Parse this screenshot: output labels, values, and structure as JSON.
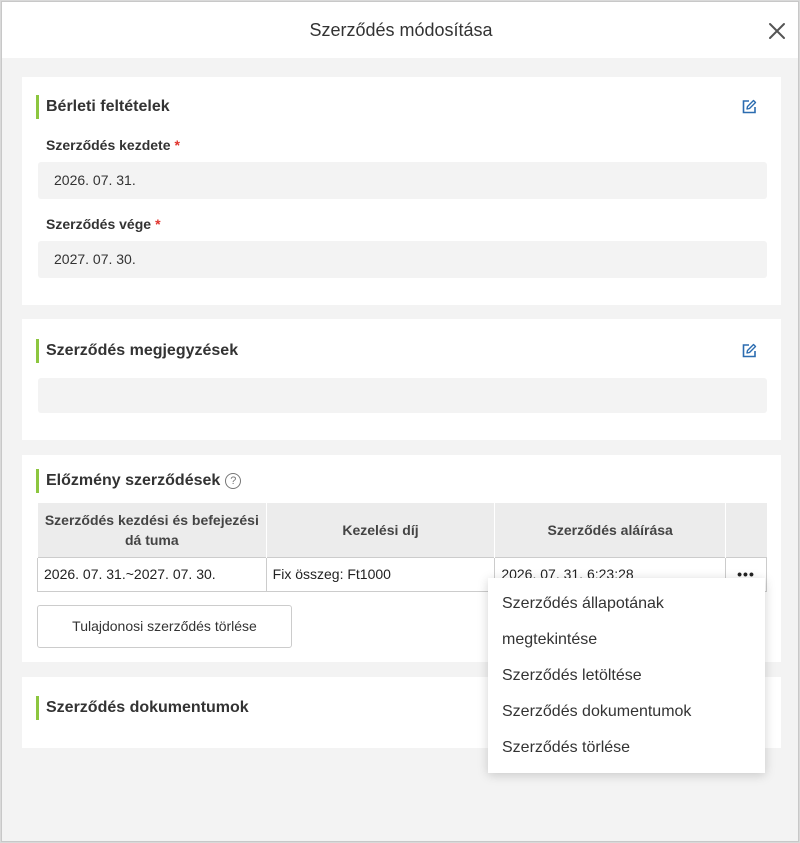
{
  "modal": {
    "title": "Szerződés módosítása"
  },
  "lease_terms": {
    "title": "Bérleti feltételek",
    "start_label": "Szerződés kezdete",
    "start_required": "*",
    "start_value": "2026. 07. 31.",
    "end_label": "Szerződés vége",
    "end_required": "*",
    "end_value": "2027. 07. 30."
  },
  "notes": {
    "title": "Szerződés megjegyzések",
    "value": ""
  },
  "history": {
    "title": "Előzmény szerződések",
    "help": "?",
    "columns": [
      "Szerződés kezdési és befejezési dá tuma",
      "Kezelési díj",
      "Szerződés aláírása",
      ""
    ],
    "rows": [
      {
        "period": "2026. 07. 31.~2027. 07. 30.",
        "fee": "Fix összeg: Ft1000",
        "signed": "2026. 07. 31. 6:23:28",
        "more": "•••"
      }
    ],
    "delete_owner_button": "Tulajdonosi szerződés törlése"
  },
  "documents": {
    "title": "Szerződés dokumentumok"
  },
  "context_menu": {
    "items": [
      "Szerződés állapotának megtekintése",
      "Szerződés letöltése",
      "Szerződés dokumentumok",
      "Szerződés törlése"
    ]
  },
  "colors": {
    "accent_bar": "#8cc63f",
    "edit_icon": "#2b6cb0",
    "required": "#e0332c"
  }
}
